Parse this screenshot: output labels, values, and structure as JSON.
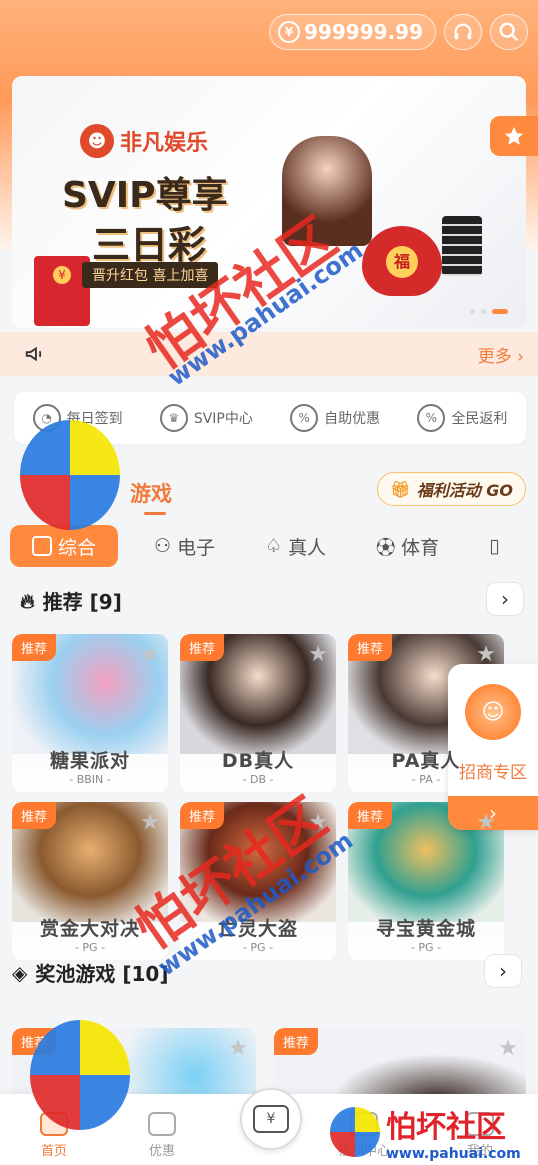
{
  "header": {
    "balance": "999999.99"
  },
  "banner": {
    "brand": "非凡娱乐",
    "headline": "SVIP尊享",
    "subline": "三日彩",
    "tagline": "晋升红包 喜上加喜",
    "bag_char": "福"
  },
  "notice": {
    "more": "更多 ›"
  },
  "quick_menu": [
    {
      "label": "每日签到",
      "icon": "bell-icon"
    },
    {
      "label": "SVIP中心",
      "icon": "crown-icon"
    },
    {
      "label": "自助优惠",
      "icon": "discount-icon"
    },
    {
      "label": "全民返利",
      "icon": "rebate-icon"
    }
  ],
  "games_tab": {
    "title": "游戏",
    "promo": "福利活动 GO"
  },
  "categories": [
    {
      "label": "综合",
      "active": true
    },
    {
      "label": "电子",
      "active": false
    },
    {
      "label": "真人",
      "active": false
    },
    {
      "label": "体育",
      "active": false
    }
  ],
  "recommended": {
    "title": "推荐 [9]",
    "items": [
      {
        "tag": "推荐",
        "name": "糖果派对",
        "provider": "- BBIN -",
        "color": "#f3a0c0"
      },
      {
        "tag": "推荐",
        "name": "DB真人",
        "provider": "- DB -",
        "color": "#c9b8a8"
      },
      {
        "tag": "推荐",
        "name": "PA真人",
        "provider": "- PA -",
        "color": "#d8c8c0"
      },
      {
        "tag": "推荐",
        "name": "赏金大对决",
        "provider": "- PG -",
        "color": "#c9a070"
      },
      {
        "tag": "推荐",
        "name": "亡灵大盗",
        "provider": "- PG -",
        "color": "#b86a4a"
      },
      {
        "tag": "推荐",
        "name": "寻宝黄金城",
        "provider": "- PG -",
        "color": "#6ac0a8"
      }
    ]
  },
  "jackpot": {
    "title": "奖池游戏 [10]",
    "items": [
      {
        "tag": "推荐"
      },
      {
        "tag": "推荐"
      }
    ]
  },
  "recruit": {
    "label": "招商专区",
    "arrow": "›"
  },
  "nav": [
    {
      "label": "首页",
      "active": true
    },
    {
      "label": "优惠",
      "active": false
    },
    {
      "label": "福利中心",
      "active": false
    },
    {
      "label": "我的",
      "active": false
    }
  ],
  "watermark": {
    "cn": "怕坏社区",
    "url": "www.pahuai.com"
  }
}
